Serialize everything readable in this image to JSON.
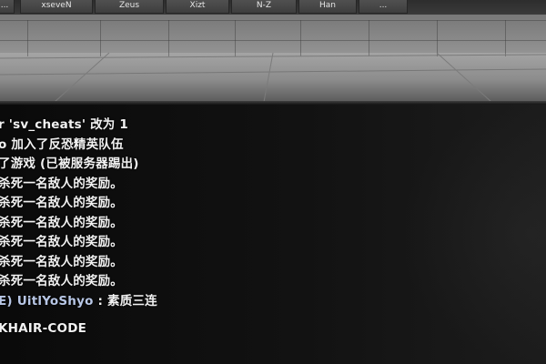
{
  "scoreboard": {
    "names": [
      "...",
      "xseveN",
      "Zeus",
      "Xizt",
      "N-Z",
      "Han",
      "..."
    ]
  },
  "console": {
    "lines": [
      "r 'sv_cheats' 改为 1",
      "o 加入了反恐精英队伍",
      "了游戏 (已被服务器踢出)",
      "杀死一名敌人的奖励。",
      "杀死一名敌人的奖励。",
      "杀死一名敌人的奖励。",
      "杀死一名敌人的奖励。",
      "杀死一名敌人的奖励。",
      "杀死一名敌人的奖励。"
    ],
    "chat": {
      "prefix": "E)",
      "sender": "UitlYoShyo",
      "separator": " : ",
      "message": "素质三连"
    },
    "footer_line": "KHAIR-CODE"
  },
  "colors": {
    "scene_gray": "#8a8a8a",
    "console_bg": "#0d0d0d",
    "text": "#f2f2f2",
    "chat_name": "#b8c7e6"
  }
}
